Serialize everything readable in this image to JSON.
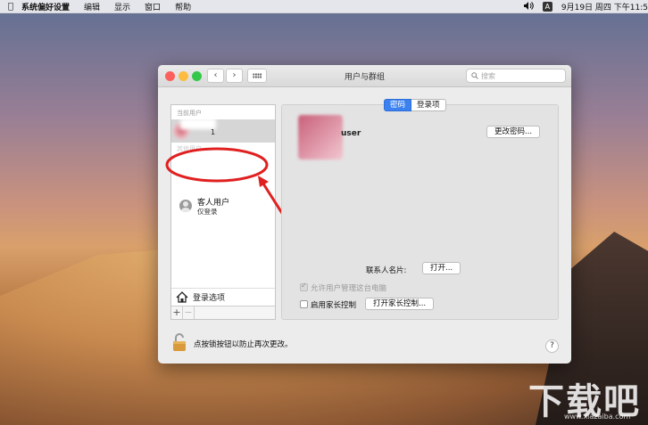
{
  "menubar": {
    "app": "系统偏好设置",
    "items": [
      "编辑",
      "显示",
      "窗口",
      "帮助"
    ],
    "input_badge": "A",
    "clock": "9月19日 周四 下午11:5"
  },
  "window": {
    "title": "用户与群组",
    "search_placeholder": "搜索",
    "back_glyph": "‹",
    "forward_glyph": "›"
  },
  "sidebar": {
    "current_users_label": "当前用户",
    "current_user_suffix": "1",
    "other_users_label": "其他用户",
    "guest": {
      "name": "客人用户",
      "subtitle": "仅登录"
    },
    "login_options": "登录选项",
    "add": "+",
    "remove": "−"
  },
  "pane": {
    "tabs": [
      "密码",
      "登录项"
    ],
    "user_name_suffix": "user",
    "change_password": "更改密码...",
    "contact_card_label": "联系人名片:",
    "open_button": "打开...",
    "allow_admin": "允许用户管理这台电脑",
    "parental_enable": "启用家长控制",
    "parental_open": "打开家长控制..."
  },
  "footer": {
    "lock_text": "点按锁按钮以防止再次更改。",
    "help": "?"
  },
  "watermark": {
    "text": "下载吧",
    "url": "www.xiazaiba.com"
  },
  "colors": {
    "accent": "#3b82f0",
    "annotation": "#e02020"
  }
}
